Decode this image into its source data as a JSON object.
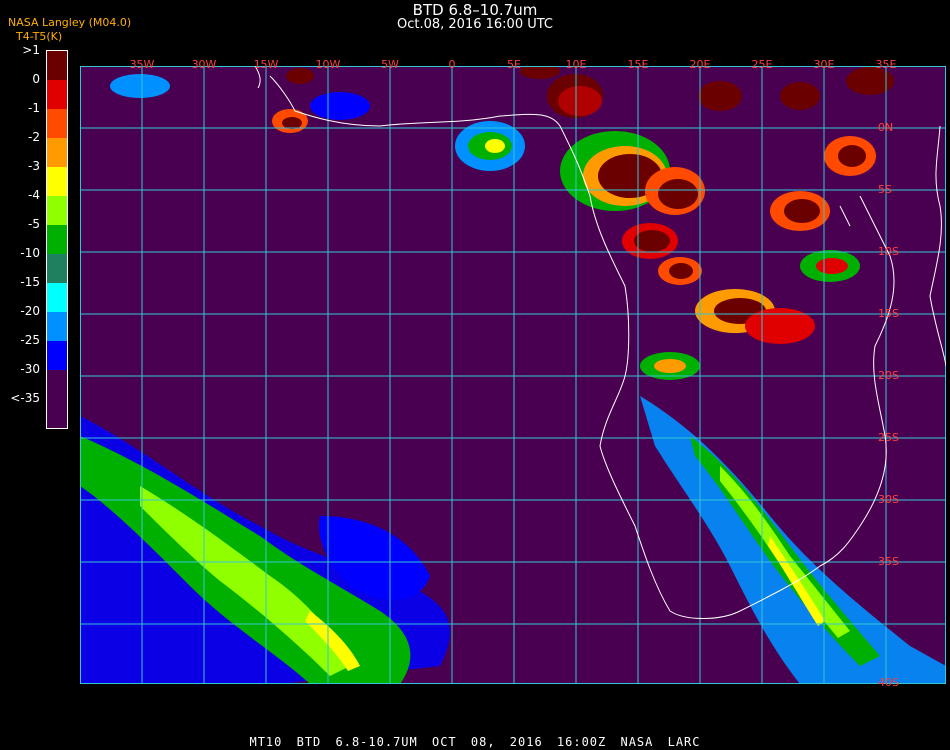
{
  "header": {
    "title": "BTD 6.8–10.7um",
    "subtitle": "Oct.08, 2016 16:00 UTC",
    "brand_line1": "NASA Langley (M04.0)",
    "brand_line2": "T4-T5(K)"
  },
  "legend": {
    "items": [
      {
        "label": ">1",
        "color": "#6b0000"
      },
      {
        "label": "0",
        "color": "#e00000"
      },
      {
        "label": "-1",
        "color": "#ff4a00"
      },
      {
        "label": "-2",
        "color": "#ff9a00"
      },
      {
        "label": "-3",
        "color": "#ffff00"
      },
      {
        "label": "-4",
        "color": "#90ff00"
      },
      {
        "label": "-5",
        "color": "#00b000"
      },
      {
        "label": "-10",
        "color": "#1f8060"
      },
      {
        "label": "-15",
        "color": "#00ffff"
      },
      {
        "label": "-20",
        "color": "#0090ff"
      },
      {
        "label": "-25",
        "color": "#0000ff"
      },
      {
        "label": "-30",
        "color": "#4a0051"
      },
      {
        "label": "<-35",
        "color": "#4a0051"
      }
    ]
  },
  "map": {
    "background_color": "#4a0051",
    "grid_color": "#33c7d6",
    "coast_color": "#ffffff",
    "lon_labels": [
      "35W",
      "30W",
      "15W",
      "10W",
      "5W",
      "0",
      "5E",
      "10E",
      "15E",
      "20E",
      "25E",
      "30E",
      "35E"
    ],
    "lat_labels": [
      "0N",
      "5S",
      "10S",
      "15S",
      "20S",
      "25S",
      "30S",
      "35S",
      "40S"
    ]
  },
  "footer": {
    "text": "MT10 BTD 6.8-10.7UM OCT 08, 2016 16:00Z NASA LARC"
  }
}
